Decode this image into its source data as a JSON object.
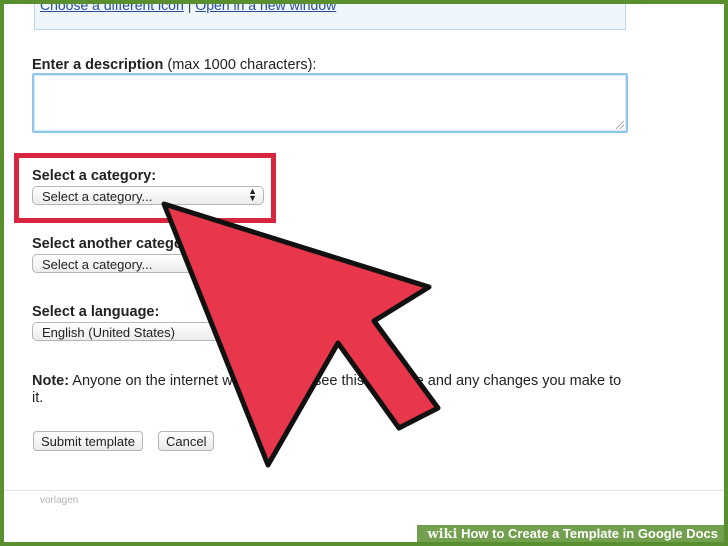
{
  "top_links": {
    "link1": "Choose a different icon",
    "separator": "|",
    "link2": "Open in a new window"
  },
  "description": {
    "label_bold": "Enter a description",
    "label_rest": " (max 1000 characters):",
    "value": ""
  },
  "category": {
    "label": "Select a category:",
    "selected": "Select a category..."
  },
  "category2": {
    "label": "Select another category (optional):",
    "selected": "Select a category..."
  },
  "language": {
    "label": "Select a language:",
    "selected": "English (United States)"
  },
  "note": {
    "bold": "Note:",
    "text": " Anyone on the internet will be able to see this template and any changes you make to it."
  },
  "buttons": {
    "submit": "Submit template",
    "cancel": "Cancel"
  },
  "footer": {
    "text": "vorlagen"
  },
  "watermark": {
    "brand": "wiki",
    "title": "How to Create a Template in Google Docs"
  },
  "colors": {
    "highlight": "#d7263d",
    "arrow": "#e8364a",
    "frame": "#5a8f2f",
    "link": "#2a4d9b"
  },
  "icons": {
    "select_arrow": "updown-chevron-icon",
    "pointer": "pointer-arrow-icon"
  }
}
